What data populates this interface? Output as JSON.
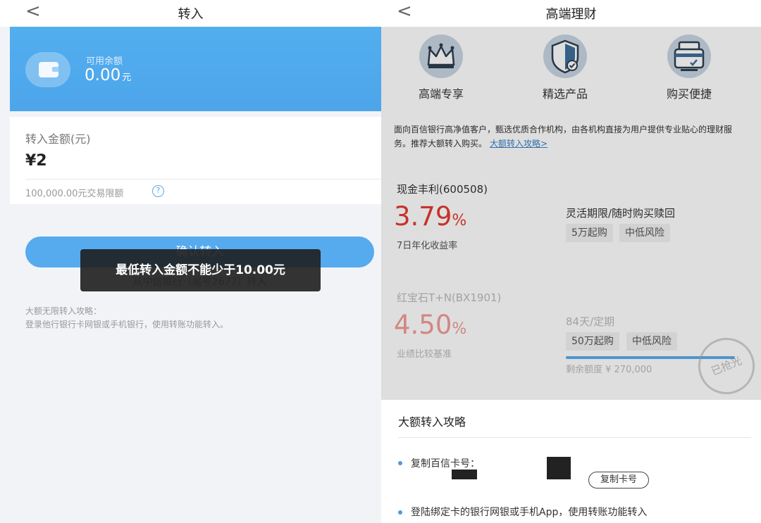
{
  "left": {
    "nav": {
      "back_glyph": "<",
      "title": "转入"
    },
    "balance": {
      "label": "可用余额",
      "value": "0.00",
      "unit": "元",
      "icon": "wallet-icon"
    },
    "amount": {
      "label": "转入金额(元)",
      "value": "¥2",
      "limit_text": "100,000.00元交易限额",
      "help_glyph": "?"
    },
    "confirm_label": "确认转入",
    "from_text": "从中信银行（尾号2677）转入",
    "tips": {
      "title": "大额无限转入攻略：",
      "body": "登录他行银行卡网银或手机银行，使用转账功能转入。"
    },
    "toast": "最低转入金额不能少于10.00元"
  },
  "right": {
    "nav": {
      "back_glyph": "<",
      "title": "高端理财"
    },
    "features": [
      {
        "label": "高端专享",
        "icon": "crown-icon"
      },
      {
        "label": "精选产品",
        "icon": "shield-icon"
      },
      {
        "label": "购买便捷",
        "icon": "card-reader-icon"
      }
    ],
    "intro": {
      "text": "面向百信银行高净值客户，甄选优质合作机构，由各机构直接为用户提供专业贴心的理财服务。推荐大额转入购买。",
      "link": "大额转入攻略>"
    },
    "products": [
      {
        "name": "现金丰利(600508)",
        "rate": "3.79",
        "rate_unit": "%",
        "rate_label": "7日年化收益率",
        "period": "灵活期限/随时购买赎回",
        "tags": [
          "5万起购",
          "中低风险"
        ]
      },
      {
        "name": "红宝石T+N(BX1901)",
        "rate": "4.50",
        "rate_unit": "%",
        "rate_label": "业绩比较基准",
        "period": "84天/定期",
        "tags": [
          "50万起购",
          "中低风险"
        ],
        "remaining": "剩余额度 ¥ 270,000",
        "stamp": "已抢光",
        "progress": 1.0
      }
    ],
    "sheet": {
      "title": "大额转入攻略",
      "step1": "复制百信卡号：",
      "copy_label": "复制卡号",
      "step2": "登陆绑定卡的银行网银或手机App，使用转账功能转入"
    }
  },
  "colors": {
    "primary_blue": "#52aeef",
    "rate_red": "#e43a32",
    "link_blue": "#3b82c4"
  }
}
